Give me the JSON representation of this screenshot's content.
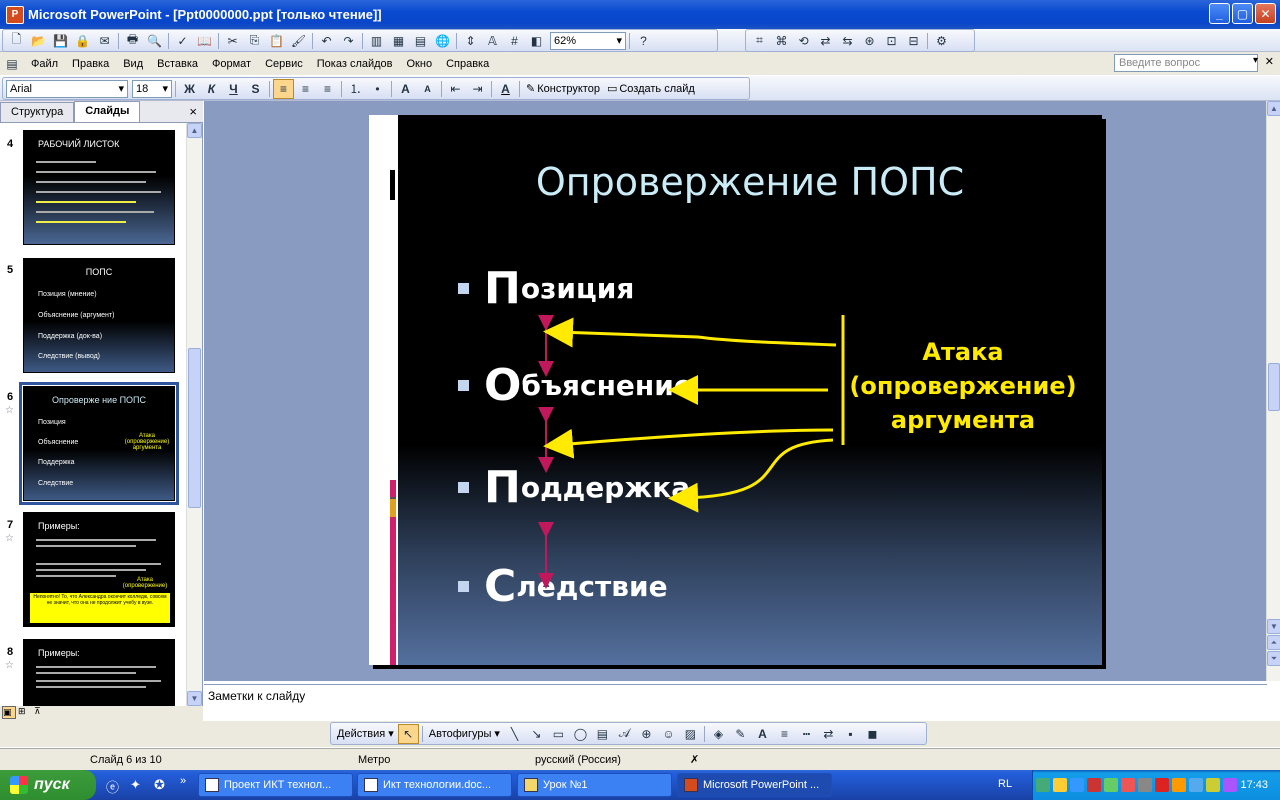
{
  "window": {
    "title": "Microsoft PowerPoint - [Ppt0000000.ppt [только чтение]]",
    "app_icon": "powerpoint-icon"
  },
  "toolbar": {
    "zoom": "62%"
  },
  "menu": {
    "items": [
      "Файл",
      "Правка",
      "Вид",
      "Вставка",
      "Формат",
      "Сервис",
      "Показ слайдов",
      "Окно",
      "Справка"
    ],
    "help_placeholder": "Введите вопрос"
  },
  "format": {
    "font": "Arial",
    "size": "18",
    "bold": "Ж",
    "italic": "К",
    "underline": "Ч",
    "shadow": "S",
    "grow": "A",
    "shrink": "A",
    "font_color": "A",
    "design": "Конструктор",
    "new_slide": "Создать слайд"
  },
  "pane": {
    "tabs": [
      "Структура",
      "Слайды"
    ],
    "close": "×"
  },
  "thumbnails": [
    {
      "num": "4",
      "title": "РАБОЧИЙ ЛИСТОК"
    },
    {
      "num": "5",
      "title": "ПОПС"
    },
    {
      "num": "6",
      "title": "Опроверже ние ПОПС"
    },
    {
      "num": "7",
      "title": "Примеры:"
    },
    {
      "num": "8",
      "title": "Примеры:"
    }
  ],
  "thumb_text": {
    "s5_b1": "Позиция (мнение)",
    "s5_b2": "Объяснение (аргумент)",
    "s5_b3": "Поддержка (док-ва)",
    "s5_b4": "Следствие (вывод)",
    "s6_b1": "Позиция",
    "s6_b2": "Объяснение",
    "s6_b3": "Поддержка",
    "s6_b4": "Следствие",
    "s6_attack": "Атака (опровержение) аргумента",
    "s7_box": "Непонятно! То, что Александра окончит колледж, совсем не значит, что она не продолжит учебу в вузе.",
    "s7_attack": "Атака (опровержение)"
  },
  "slide": {
    "title": "Опровержение ПОПС",
    "bullets": [
      {
        "first": "П",
        "rest": "озиция"
      },
      {
        "first": "О",
        "rest": "бъяснение"
      },
      {
        "first": "П",
        "rest": "оддержка"
      },
      {
        "first": "С",
        "rest": "ледствие"
      }
    ],
    "attack": [
      "Атака",
      "(опровержение)",
      "аргумента"
    ]
  },
  "notes": {
    "placeholder": "Заметки к слайду"
  },
  "drawing": {
    "actions": "Действия",
    "autoshapes": "Автофигуры"
  },
  "status": {
    "slide": "Слайд 6 из 10",
    "design": "Метро",
    "language": "русский (Россия)"
  },
  "taskbar": {
    "start": "пуск",
    "tasks": [
      "Проект ИКТ технол...",
      "Икт технологии.doc...",
      "Урок №1",
      "Microsoft PowerPoint ..."
    ],
    "lang": "RL",
    "clock": "17:43"
  },
  "colors": {
    "title_bar": "#0a4ad0",
    "slide_title": "#c9ecf7",
    "attack_text": "#ffea00",
    "arrow_red": "#c0185a"
  }
}
